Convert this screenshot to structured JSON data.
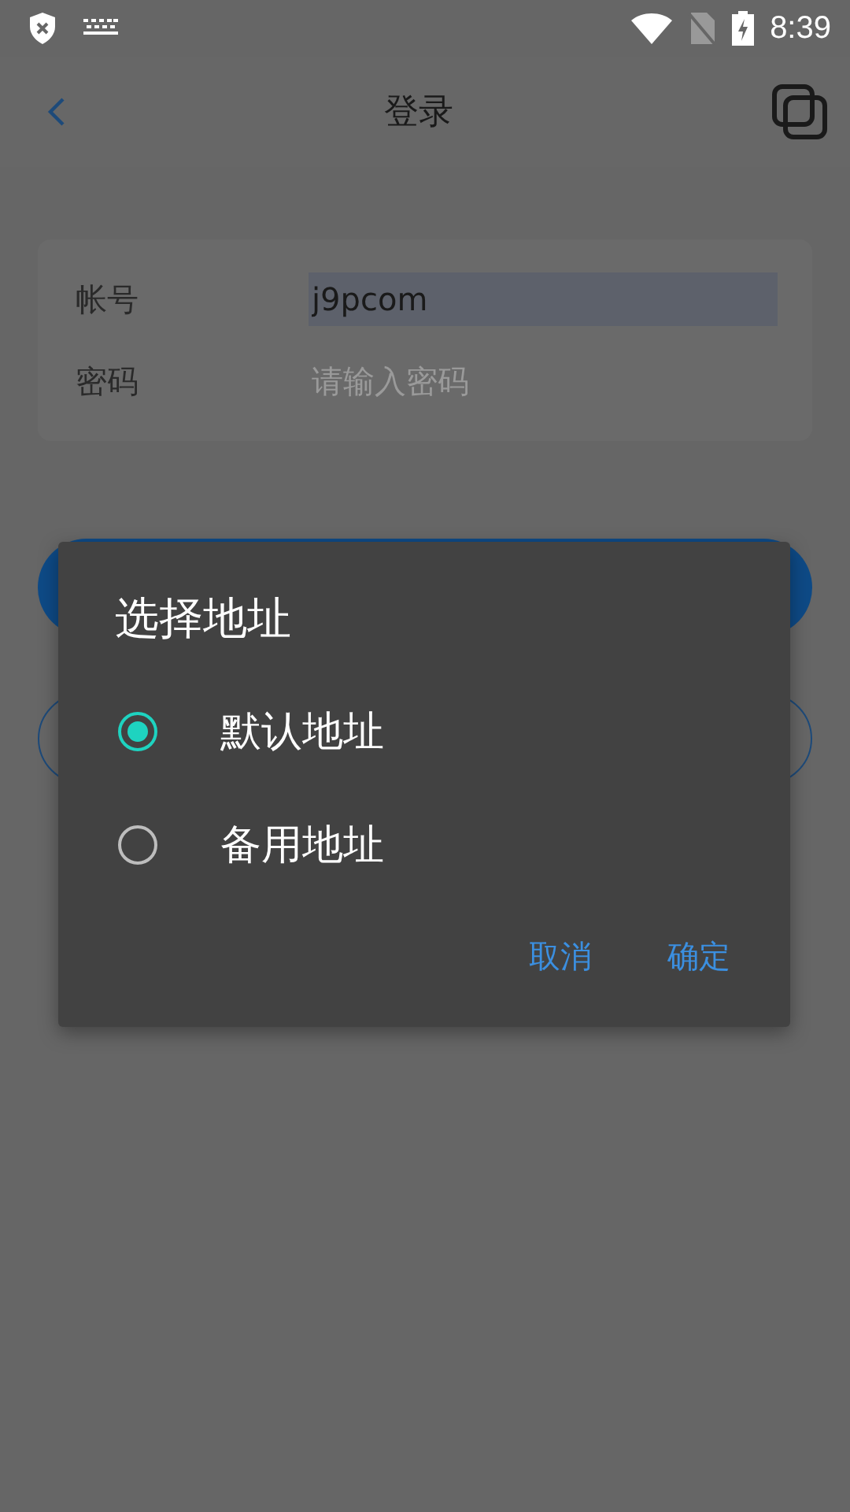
{
  "status_bar": {
    "time": "8:39"
  },
  "header": {
    "title": "登录"
  },
  "form": {
    "fields": [
      {
        "label": "帐号",
        "value": "j9pcom",
        "highlighted": true
      },
      {
        "label": "密码",
        "placeholder": "请输入密码",
        "highlighted": false
      }
    ]
  },
  "dialog": {
    "title": "选择地址",
    "options": [
      {
        "label": "默认地址",
        "selected": true
      },
      {
        "label": "备用地址",
        "selected": false
      }
    ],
    "buttons": [
      "取消",
      "确定"
    ]
  }
}
